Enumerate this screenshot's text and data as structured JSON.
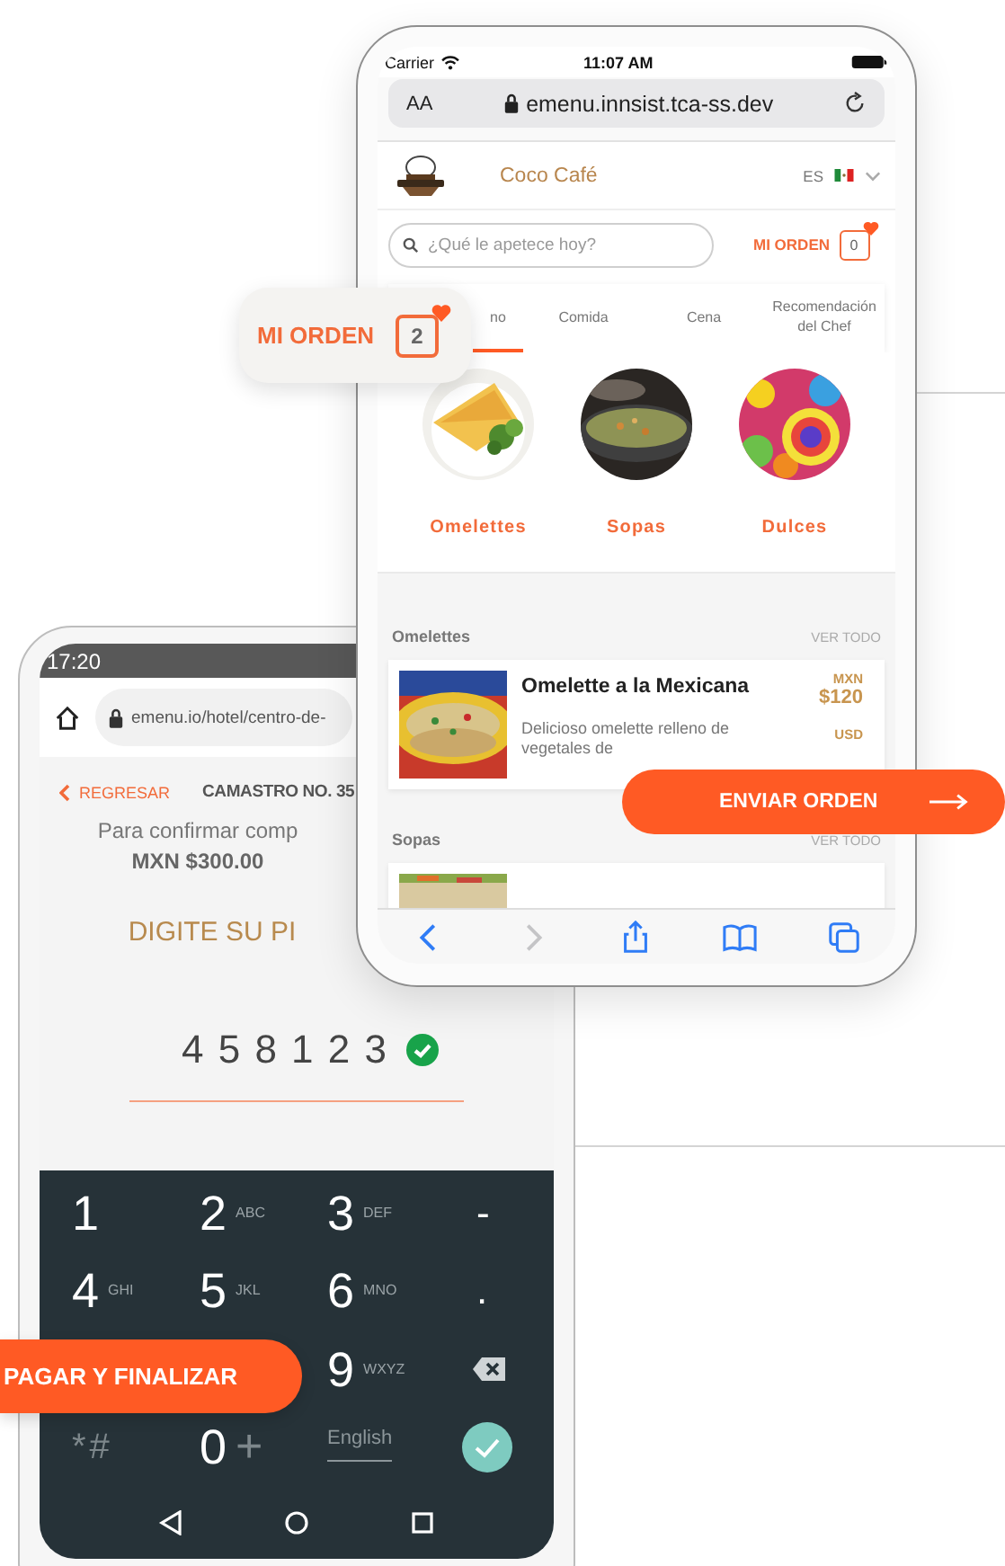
{
  "ios_phone": {
    "status_bar": {
      "carrier": "Carrier",
      "time": "11:07 AM"
    },
    "address_bar": {
      "text_size": "AA",
      "url": "emenu.innsist.tca-ss.dev"
    },
    "header": {
      "restaurant": "Coco Café",
      "language": "ES"
    },
    "search": {
      "placeholder": "¿Qué le apetece hoy?"
    },
    "order": {
      "label": "MI ORDEN",
      "count": "0"
    },
    "tabs": [
      {
        "label": "no",
        "selected": true
      },
      {
        "label": "Comida",
        "selected": false
      },
      {
        "label": "Cena",
        "selected": false
      },
      {
        "label": "Recomendación del Chef",
        "selected": false
      }
    ],
    "categories": [
      {
        "label": "Omelettes",
        "kind": "picture"
      },
      {
        "label": "Sopas",
        "kind": "picture"
      },
      {
        "label": "Dulces",
        "kind": "picture"
      }
    ],
    "sections": [
      {
        "title": "Omelettes",
        "link": "VER TODO",
        "items": [
          {
            "kind": "full",
            "name": "Omelette a la Mexicana",
            "currency": "MXN",
            "price": "$120",
            "description": "Delicioso omelette relleno de vegetales de",
            "second_currency": "USD"
          }
        ]
      },
      {
        "title": "Sopas",
        "link": "VER TODO",
        "items": [
          {
            "kind": "partial"
          }
        ]
      }
    ],
    "toolbar": [
      {
        "kind": "back",
        "disabled": false
      },
      {
        "kind": "forward",
        "disabled": true
      },
      {
        "kind": "share",
        "disabled": false
      },
      {
        "kind": "bookmarks",
        "disabled": false
      },
      {
        "kind": "tabs",
        "disabled": false
      }
    ]
  },
  "android_phone": {
    "status_bar": {
      "time": "17:20"
    },
    "url": "emenu.io/hotel/centro-de-",
    "back_link": "REGRESAR",
    "title": "CAMASTRO NO. 35",
    "message": "Para confirmar comp",
    "amount": "MXN $300.00",
    "pin_prompt": "DIGITE SU PI",
    "pin": "4 5 8 1 2 3",
    "pin_valid": true,
    "keypad": [
      {
        "keys": [
          {
            "kind": "digit",
            "main": "1"
          },
          {
            "kind": "digit",
            "main": "2",
            "sub": "ABC"
          },
          {
            "kind": "digit",
            "main": "3",
            "sub": "DEF"
          },
          {
            "kind": "symbol",
            "main": "-"
          }
        ]
      },
      {
        "keys": [
          {
            "kind": "digit",
            "main": "4",
            "sub": "GHI"
          },
          {
            "kind": "digit",
            "main": "5",
            "sub": "JKL"
          },
          {
            "kind": "digit",
            "main": "6",
            "sub": "MNO"
          },
          {
            "kind": "symbol",
            "main": "."
          }
        ]
      },
      {
        "keys": [
          {
            "kind": "digit",
            "main": "9",
            "sub": "WXYZ"
          },
          {
            "kind": "backspace"
          }
        ]
      },
      {
        "keys": [
          {
            "kind": "muted",
            "main": "*#"
          },
          {
            "kind": "plus",
            "main": "0",
            "sub": "+"
          },
          {
            "kind": "language",
            "main": "English"
          },
          {
            "kind": "done"
          }
        ]
      }
    ]
  },
  "floating_order": {
    "label": "MI ORDEN",
    "count": "2"
  },
  "send_button": "ENVIAR ORDEN",
  "pay_button": "PAGAR Y FINALIZAR"
}
